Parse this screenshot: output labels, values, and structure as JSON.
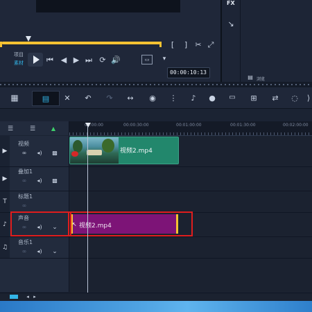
{
  "preview": {
    "fx_label": "FX",
    "project_label": "项目",
    "clip_label": "素材",
    "timecode": "00:00:10:13",
    "browse_label": "浏览"
  },
  "ruler": {
    "ticks": [
      "00:00:00",
      "00:00:30:00",
      "00:01:00:00",
      "00:01:30:00",
      "00:02:00:00"
    ]
  },
  "tracks": {
    "video": {
      "name": "视频",
      "clip": "视频2.mp4"
    },
    "overlay": {
      "name": "叠加1"
    },
    "title": {
      "name": "标题1"
    },
    "voice": {
      "name": "声音",
      "clip": "视频2.mp4"
    },
    "music": {
      "name": "音乐1"
    }
  },
  "colors": {
    "video_clip": "#22876c",
    "audio_clip": "#7d1477",
    "highlight_box": "#e01d1d",
    "play_accent": "#33b4e6"
  }
}
